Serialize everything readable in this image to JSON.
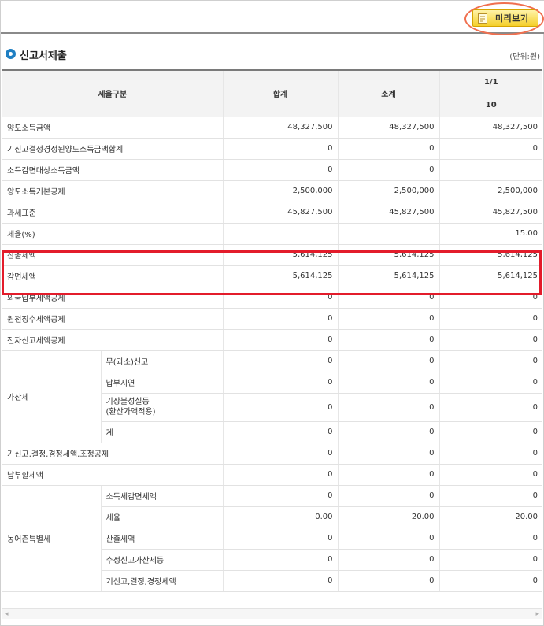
{
  "toolbar": {
    "preview_label": "미리보기",
    "preview_icon": "document-icon"
  },
  "section": {
    "title": "신고서제출",
    "unit": "(단위:원)"
  },
  "header": {
    "col_item": "세율구분",
    "col_total": "합계",
    "col_subtotal": "소계",
    "col_group": "1/1",
    "col_rate": "10"
  },
  "rows": [
    {
      "label": "양도소득금액",
      "total": "48,327,500",
      "subtotal": "48,327,500",
      "rate10": "48,327,500"
    },
    {
      "label": "기신고결정경정된양도소득금액합계",
      "total": "0",
      "subtotal": "0",
      "rate10": "0"
    },
    {
      "label": "소득감면대상소득금액",
      "total": "0",
      "subtotal": "0",
      "rate10": ""
    },
    {
      "label": "양도소득기본공제",
      "total": "2,500,000",
      "subtotal": "2,500,000",
      "rate10": "2,500,000"
    },
    {
      "label": "과세표준",
      "total": "45,827,500",
      "subtotal": "45,827,500",
      "rate10": "45,827,500"
    },
    {
      "label": "세율(%)",
      "total": "",
      "subtotal": "",
      "rate10": "15.00"
    },
    {
      "label": "산출세액",
      "total": "5,614,125",
      "subtotal": "5,614,125",
      "rate10": "5,614,125"
    },
    {
      "label": "감면세액",
      "total": "5,614,125",
      "subtotal": "5,614,125",
      "rate10": "5,614,125"
    },
    {
      "label": "외국납부세액공제",
      "total": "0",
      "subtotal": "0",
      "rate10": "0"
    },
    {
      "label": "원천징수세액공제",
      "total": "0",
      "subtotal": "0",
      "rate10": "0"
    },
    {
      "label": "전자신고세액공제",
      "total": "0",
      "subtotal": "0",
      "rate10": "0"
    }
  ],
  "penalty": {
    "group": "가산세",
    "items": [
      {
        "label": "무(과소)신고",
        "total": "0",
        "subtotal": "0",
        "rate10": "0"
      },
      {
        "label": "납부지연",
        "total": "0",
        "subtotal": "0",
        "rate10": "0"
      },
      {
        "label_line1": "기장불성실등",
        "label_line2": "(환산가액적용)",
        "total": "0",
        "subtotal": "0",
        "rate10": "0"
      },
      {
        "label": "계",
        "total": "0",
        "subtotal": "0",
        "rate10": "0"
      }
    ]
  },
  "rows2": [
    {
      "label": "기신고,결정,경정세액,조정공제",
      "total": "0",
      "subtotal": "0",
      "rate10": "0"
    },
    {
      "label": "납부할세액",
      "total": "0",
      "subtotal": "0",
      "rate10": "0"
    }
  ],
  "special": {
    "group": "농어촌특별세",
    "items": [
      {
        "label": "소득세감면세액",
        "total": "0",
        "subtotal": "0",
        "rate10": "0"
      },
      {
        "label": "세율",
        "total": "0.00",
        "subtotal": "20.00",
        "rate10": "20.00"
      },
      {
        "label": "산출세액",
        "total": "0",
        "subtotal": "0",
        "rate10": "0"
      },
      {
        "label": "수정신고가산세등",
        "total": "0",
        "subtotal": "0",
        "rate10": "0"
      },
      {
        "label": "기신고,결정,경정세액",
        "total": "0",
        "subtotal": "0",
        "rate10": "0"
      }
    ]
  },
  "colors": {
    "accent": "#1f7fc3",
    "highlight": "#e31c2b",
    "annotation": "#f07050",
    "button": "#f4cf2a"
  }
}
